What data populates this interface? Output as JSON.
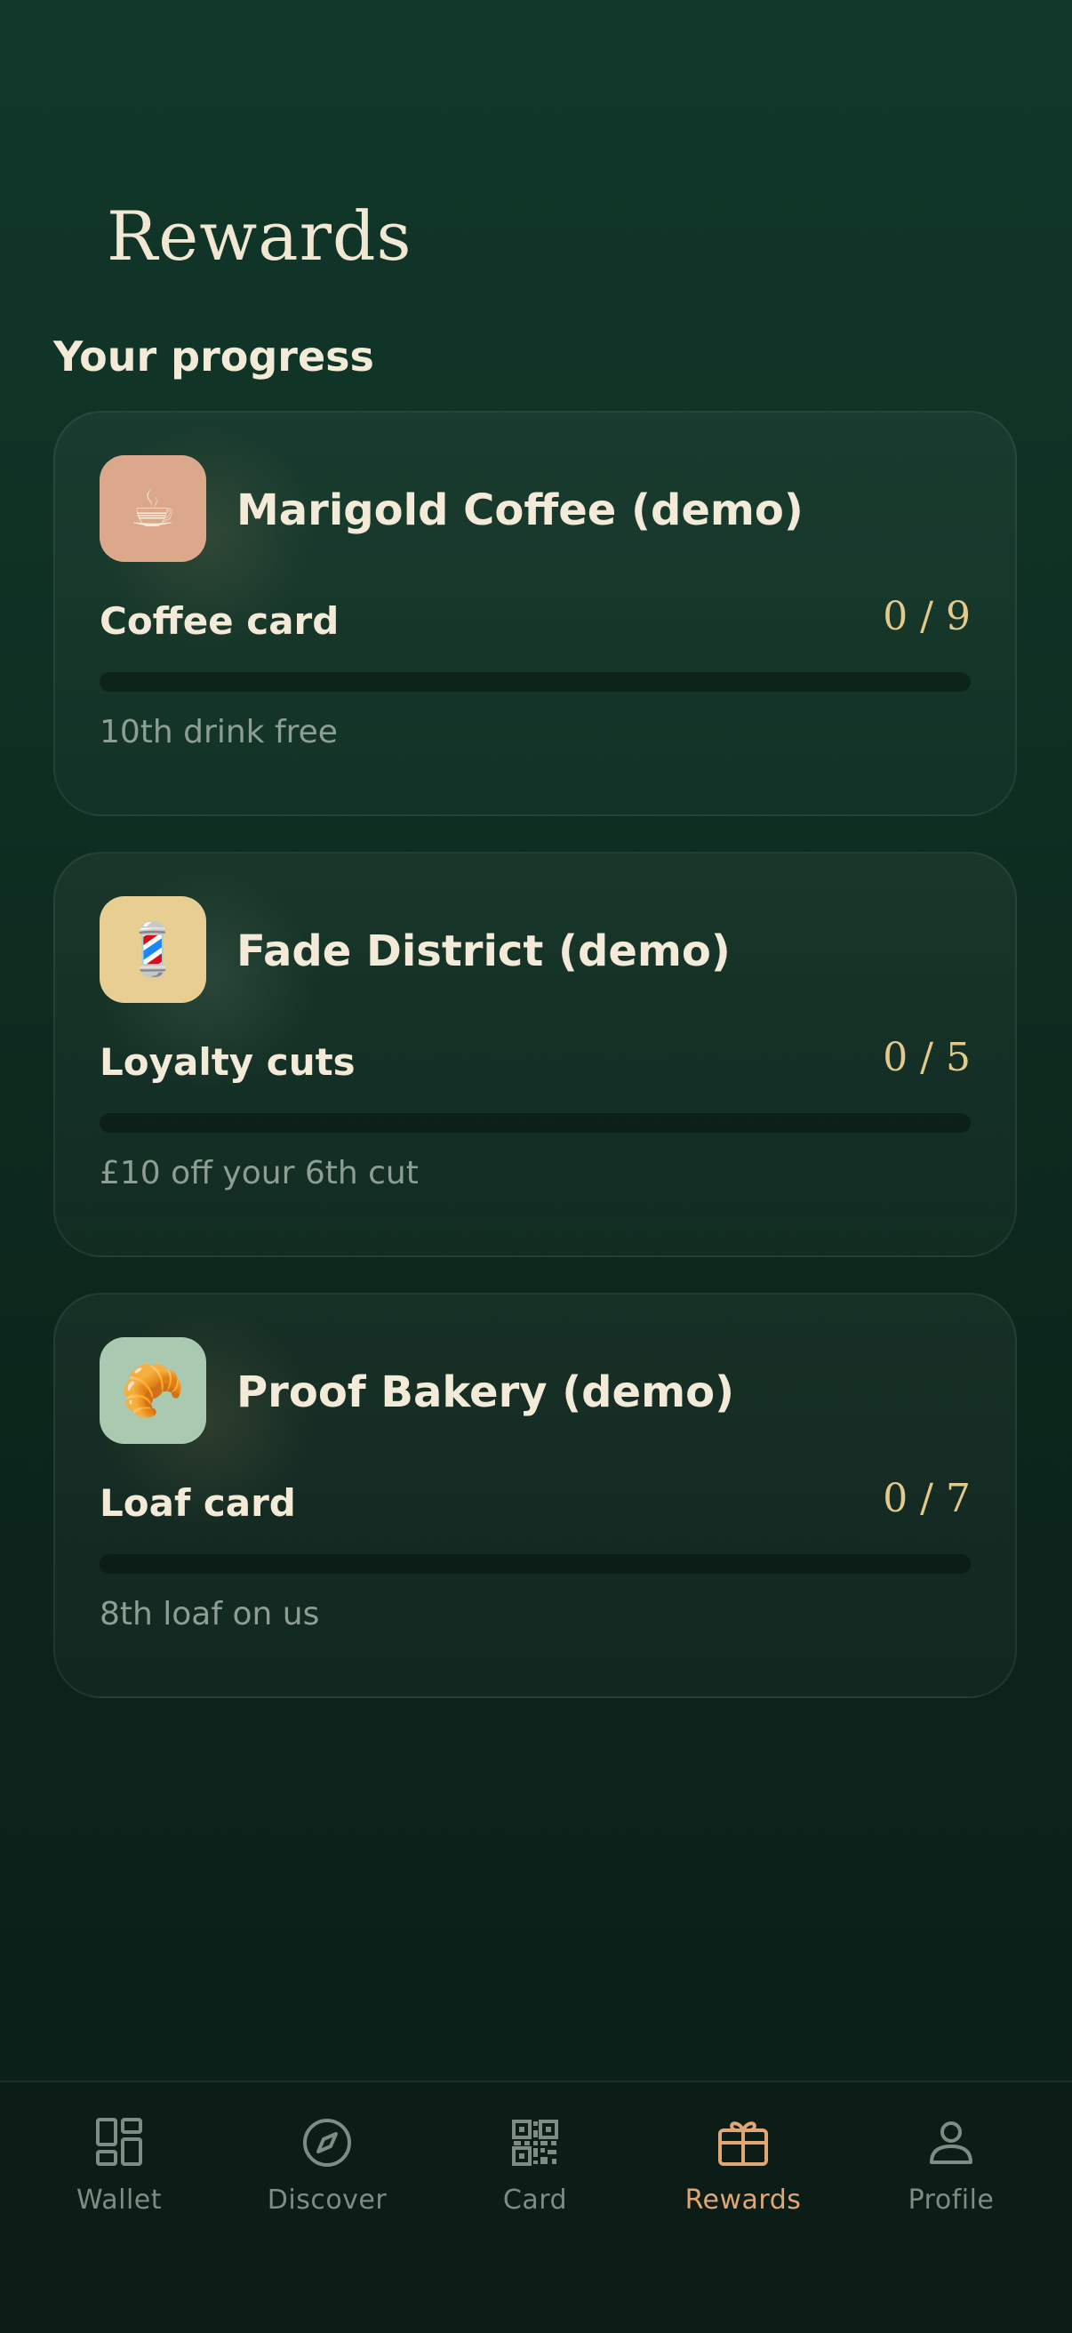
{
  "page": {
    "title": "Rewards",
    "section_title": "Your progress"
  },
  "cards": [
    {
      "merchant": "Marigold Coffee (demo)",
      "icon": "coffee-cup-emoji",
      "emoji": "☕",
      "logo_bg": "#dba88c",
      "program": "Coffee card",
      "progress_text": "0 / 9",
      "stamps": 0,
      "total": 9,
      "reward": "10th drink free"
    },
    {
      "merchant": "Fade District (demo)",
      "icon": "barber-pole-emoji",
      "emoji": "💈",
      "logo_bg": "#e8cf91",
      "program": "Loyalty cuts",
      "progress_text": "0 / 5",
      "stamps": 0,
      "total": 5,
      "reward": "£10 off your 6th cut"
    },
    {
      "merchant": "Proof Bakery (demo)",
      "icon": "croissant-emoji",
      "emoji": "🥐",
      "logo_bg": "#a9c9b1",
      "program": "Loaf card",
      "progress_text": "0 / 7",
      "stamps": 0,
      "total": 7,
      "reward": "8th loaf on us"
    }
  ],
  "tabs": [
    {
      "label": "Wallet",
      "icon": "wallet-grid-icon",
      "active": false
    },
    {
      "label": "Discover",
      "icon": "compass-icon",
      "active": false
    },
    {
      "label": "Card",
      "icon": "qr-code-icon",
      "active": false
    },
    {
      "label": "Rewards",
      "icon": "gift-icon",
      "active": true
    },
    {
      "label": "Profile",
      "icon": "user-icon",
      "active": false
    }
  ],
  "colors": {
    "background": "#0f3124",
    "accent": "#e0a676",
    "count_gold": "#e4c98c",
    "tab_inactive": "#7f8c84"
  }
}
